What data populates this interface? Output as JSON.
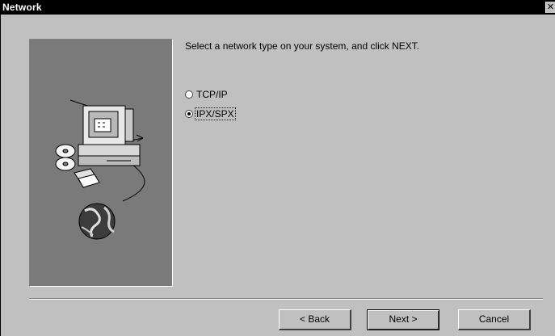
{
  "window": {
    "title": "Network",
    "close_glyph": "✕"
  },
  "content": {
    "instruction": "Select a network type on your system, and click NEXT."
  },
  "options": [
    {
      "label": "TCP/IP",
      "checked": false
    },
    {
      "label": "IPX/SPX",
      "checked": true
    }
  ],
  "buttons": {
    "back": "< Back",
    "next": "Next >",
    "cancel": "Cancel"
  },
  "illustration": {
    "icon": "computer-network-icon"
  }
}
